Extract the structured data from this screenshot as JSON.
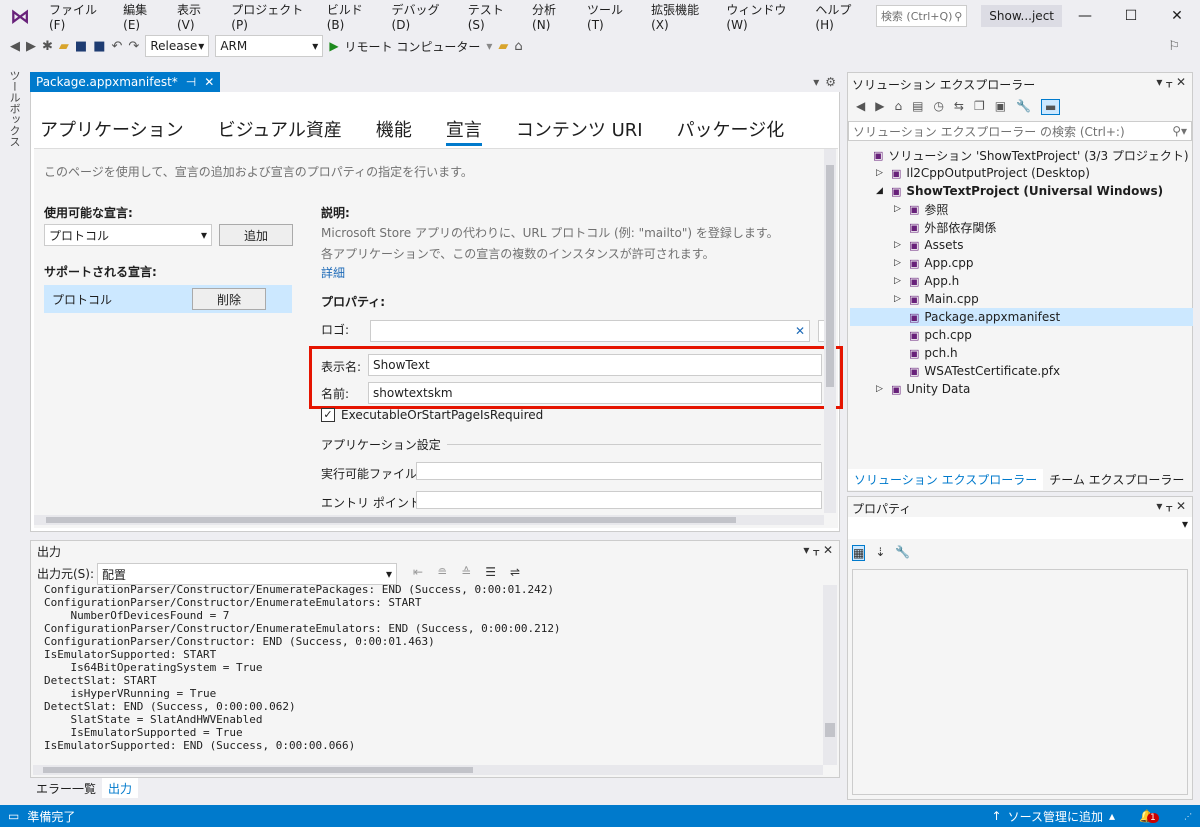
{
  "menu": {
    "items": [
      "ファイル(F)",
      "編集(E)",
      "表示(V)",
      "プロジェクト(P)",
      "ビルド(B)",
      "デバッグ(D)",
      "テスト(S)",
      "分析(N)",
      "ツール(T)",
      "拡張機能(X)",
      "ウィンドウ(W)",
      "ヘルプ(H)"
    ],
    "search_placeholder": "検索 (Ctrl+Q)",
    "solution_title": "Show...ject"
  },
  "toolbar": {
    "config": "Release",
    "platform": "ARM",
    "run_label": "リモート コンピューター"
  },
  "toolbox_label": "ツールボックス",
  "doc": {
    "tab_label": "Package.appxmanifest*",
    "tabs": [
      "アプリケーション",
      "ビジュアル資産",
      "機能",
      "宣言",
      "コンテンツ URI",
      "パッケージ化"
    ],
    "active_tab": "宣言",
    "intro": "このページを使用して、宣言の追加および宣言のプロパティの指定を行います。",
    "available_label": "使用可能な宣言:",
    "available_value": "プロトコル",
    "add_button": "追加",
    "supported_label": "サポートされる宣言:",
    "supported_item": "プロトコル",
    "delete_button": "削除",
    "desc_label": "説明:",
    "desc_line1": "Microsoft Store アプリの代わりに、URL プロトコル (例: \"mailto\") を登録します。",
    "desc_line2": "各アプリケーションで、この宣言の複数のインスタンスが許可されます。",
    "more_link": "詳細",
    "props_label": "プロパティ:",
    "logo_label": "ロゴ:",
    "display_name_label": "表示名:",
    "display_name_value": "ShowText",
    "name_label": "名前:",
    "name_value": "showtextskm",
    "checkbox_label": "ExecutableOrStartPageIsRequired",
    "checkbox_checked": true,
    "app_settings_label": "アプリケーション設定",
    "exe_label": "実行可能ファイル:",
    "entry_label": "エントリ ポイント:"
  },
  "output": {
    "title": "出力",
    "source_label": "出力元(S):",
    "source_value": "配置",
    "lines": [
      "ConfigurationParser/Constructor/EnumeratePackages: END (Success, 0:00:01.242)",
      "ConfigurationParser/Constructor/EnumerateEmulators: START",
      "    NumberOfDevicesFound = 7",
      "ConfigurationParser/Constructor/EnumerateEmulators: END (Success, 0:00:00.212)",
      "ConfigurationParser/Constructor: END (Success, 0:00:01.463)",
      "IsEmulatorSupported: START",
      "    Is64BitOperatingSystem = True",
      "DetectSlat: START",
      "    isHyperVRunning = True",
      "DetectSlat: END (Success, 0:00:00.062)",
      "    SlatState = SlatAndHWVEnabled",
      "    IsEmulatorSupported = True",
      "IsEmulatorSupported: END (Success, 0:00:00.066)"
    ],
    "tabs": [
      "エラー一覧",
      "出力"
    ]
  },
  "solution_explorer": {
    "title": "ソリューション エクスプローラー",
    "search_placeholder": "ソリューション エクスプローラー の検索 (Ctrl+:)",
    "nodes": [
      {
        "label": "ソリューション 'ShowTextProject' (3/3 プロジェクト)",
        "depth": 0,
        "arrow": ""
      },
      {
        "label": "Il2CppOutputProject (Desktop)",
        "depth": 1,
        "arrow": "▷"
      },
      {
        "label": "ShowTextProject (Universal Windows)",
        "depth": 1,
        "arrow": "◢",
        "bold": true
      },
      {
        "label": "参照",
        "depth": 2,
        "arrow": "▷"
      },
      {
        "label": "外部依存関係",
        "depth": 2,
        "arrow": ""
      },
      {
        "label": "Assets",
        "depth": 2,
        "arrow": "▷"
      },
      {
        "label": "App.cpp",
        "depth": 2,
        "arrow": "▷"
      },
      {
        "label": "App.h",
        "depth": 2,
        "arrow": "▷"
      },
      {
        "label": "Main.cpp",
        "depth": 2,
        "arrow": "▷"
      },
      {
        "label": "Package.appxmanifest",
        "depth": 2,
        "arrow": "",
        "selected": true
      },
      {
        "label": "pch.cpp",
        "depth": 2,
        "arrow": ""
      },
      {
        "label": "pch.h",
        "depth": 2,
        "arrow": ""
      },
      {
        "label": "WSATestCertificate.pfx",
        "depth": 2,
        "arrow": ""
      },
      {
        "label": "Unity Data",
        "depth": 1,
        "arrow": "▷"
      }
    ],
    "tabs": [
      "ソリューション エクスプローラー",
      "チーム エクスプローラー"
    ]
  },
  "properties": {
    "title": "プロパティ"
  },
  "status": {
    "text": "準備完了",
    "source_control": "ソース管理に追加",
    "notifications": "1"
  },
  "colors": {
    "accent": "#007acc",
    "highlight": "#e51400"
  }
}
